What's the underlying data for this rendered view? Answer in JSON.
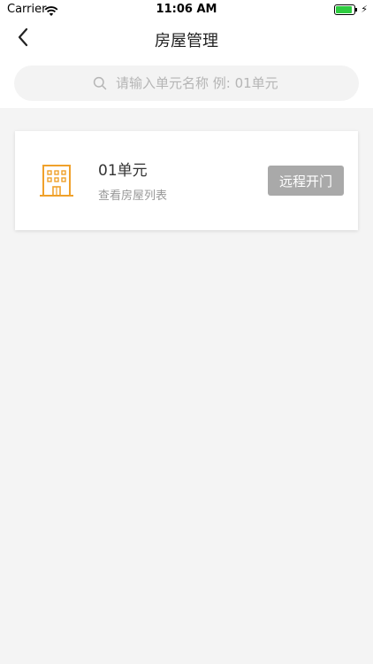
{
  "status_bar": {
    "carrier": "Carrier",
    "time": "11:06 AM"
  },
  "nav": {
    "title": "房屋管理",
    "back_icon": "chevron-left-icon"
  },
  "search": {
    "placeholder": "请输入单元名称 例: 01单元",
    "value": "",
    "icon": "search-icon"
  },
  "units": [
    {
      "name": "01单元",
      "subtitle": "查看房屋列表",
      "action_label": "远程开门",
      "icon": "building-icon"
    }
  ],
  "colors": {
    "accent": "#f0a12b",
    "button_disabled": "#a9a9a9",
    "background": "#f4f4f4",
    "battery": "#2ecc40"
  }
}
